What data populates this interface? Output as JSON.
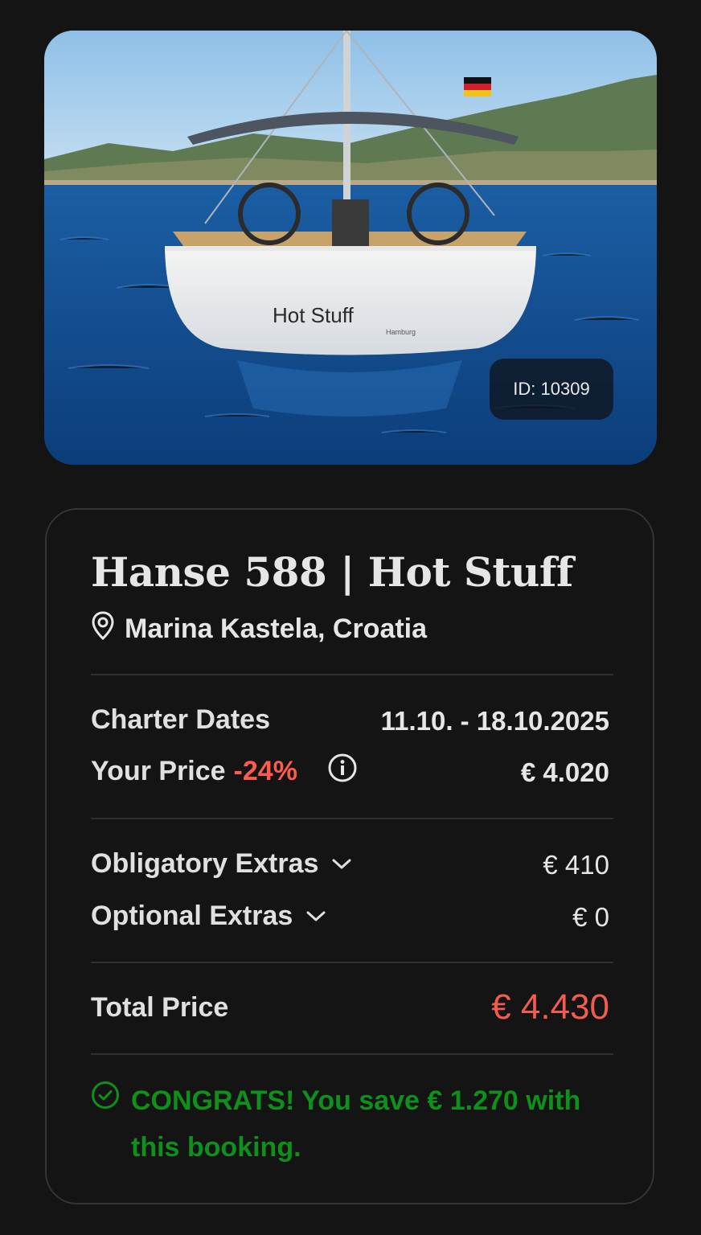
{
  "listing": {
    "id_badge": "ID: 10309",
    "boat_name_on_hull": "Hot Stuff",
    "hull_port": "Hamburg"
  },
  "card": {
    "title": "Hanse 588 | Hot Stuff",
    "location": "Marina Kastela, Croatia",
    "charter_dates_label": "Charter Dates",
    "charter_dates_value": "11.10. - 18.10.2025",
    "your_price_label": "Your Price",
    "discount": "-24%",
    "your_price_value": "€ 4.020",
    "obligatory_extras_label": "Obligatory Extras",
    "obligatory_extras_value": "€ 410",
    "optional_extras_label": "Optional Extras",
    "optional_extras_value": "€ 0",
    "total_price_label": "Total Price",
    "total_price_value": "€ 4.430",
    "congrats_text": "CONGRATS! You save € 1.270 with this booking."
  },
  "colors": {
    "background": "#141414",
    "discount_red": "#ff5a4e",
    "total_red": "#f25b4e",
    "success_green": "#0f8f1b"
  },
  "icons": [
    "map-pin-icon",
    "info-icon",
    "chevron-down-icon",
    "check-circle-icon"
  ]
}
